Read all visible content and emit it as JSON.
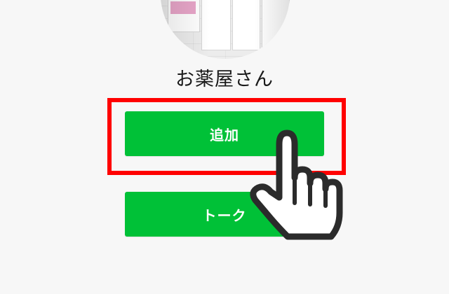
{
  "profile": {
    "name": "お薬屋さん",
    "image_icon": "pharmacy-storefront-photo"
  },
  "actions": {
    "add_label": "追加",
    "talk_label": "トーク"
  },
  "annotation": {
    "highlight_color": "#ff0000",
    "pointer_icon": "hand-pointer-icon"
  },
  "theme": {
    "button_color": "#00c137",
    "background": "#f7f7f7"
  }
}
